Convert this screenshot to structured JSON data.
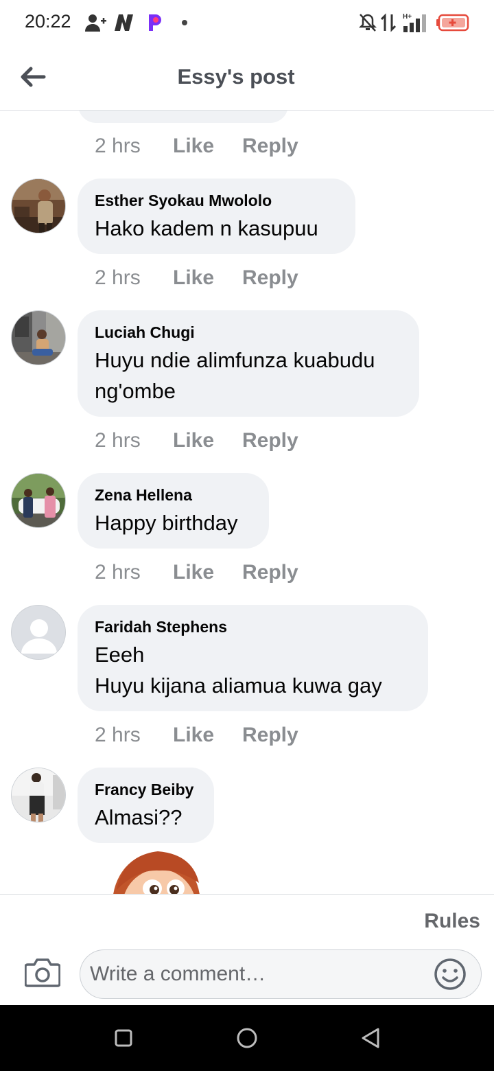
{
  "status_bar": {
    "time": "20:22",
    "network_label": "H+",
    "icons": [
      "person-add-icon",
      "n-app-icon",
      "p-app-icon",
      "dot-icon",
      "mute-icon",
      "data-transfer-icon",
      "signal-icon",
      "battery-low-icon"
    ],
    "battery_color": "#e64a3c"
  },
  "header": {
    "title": "Essy's post",
    "back_icon": "arrow-left-icon"
  },
  "first_meta": {
    "time": "2 hrs",
    "like": "Like",
    "reply": "Reply"
  },
  "comments": [
    {
      "author": "Esther Syokau Mwololo",
      "text": "Hako kadem n kasupuu",
      "time": "2 hrs",
      "like": "Like",
      "reply": "Reply"
    },
    {
      "author": "Luciah Chugi",
      "text": "Huyu ndie alimfunza kuabudu\nng'ombe",
      "time": "2 hrs",
      "like": "Like",
      "reply": "Reply"
    },
    {
      "author": "Zena Hellena",
      "text": "Happy birthday",
      "time": "2 hrs",
      "like": "Like",
      "reply": "Reply"
    },
    {
      "author": "Faridah Stephens",
      "text": "Eeeh\nHuyu kijana aliamua kuwa gay",
      "time": "2 hrs",
      "like": "Like",
      "reply": "Reply"
    },
    {
      "author": "Francy Beiby",
      "text": "Almasi??"
    }
  ],
  "composer": {
    "rules_label": "Rules",
    "placeholder": "Write a comment…",
    "camera_icon": "camera-icon",
    "emoji_icon": "smiley-icon"
  },
  "nav": {
    "icons": [
      "square-recents-icon",
      "circle-home-icon",
      "triangle-back-icon"
    ]
  },
  "colors": {
    "bubble": "#f0f2f5",
    "meta": "#8a8d91",
    "title": "#4b4f56"
  }
}
